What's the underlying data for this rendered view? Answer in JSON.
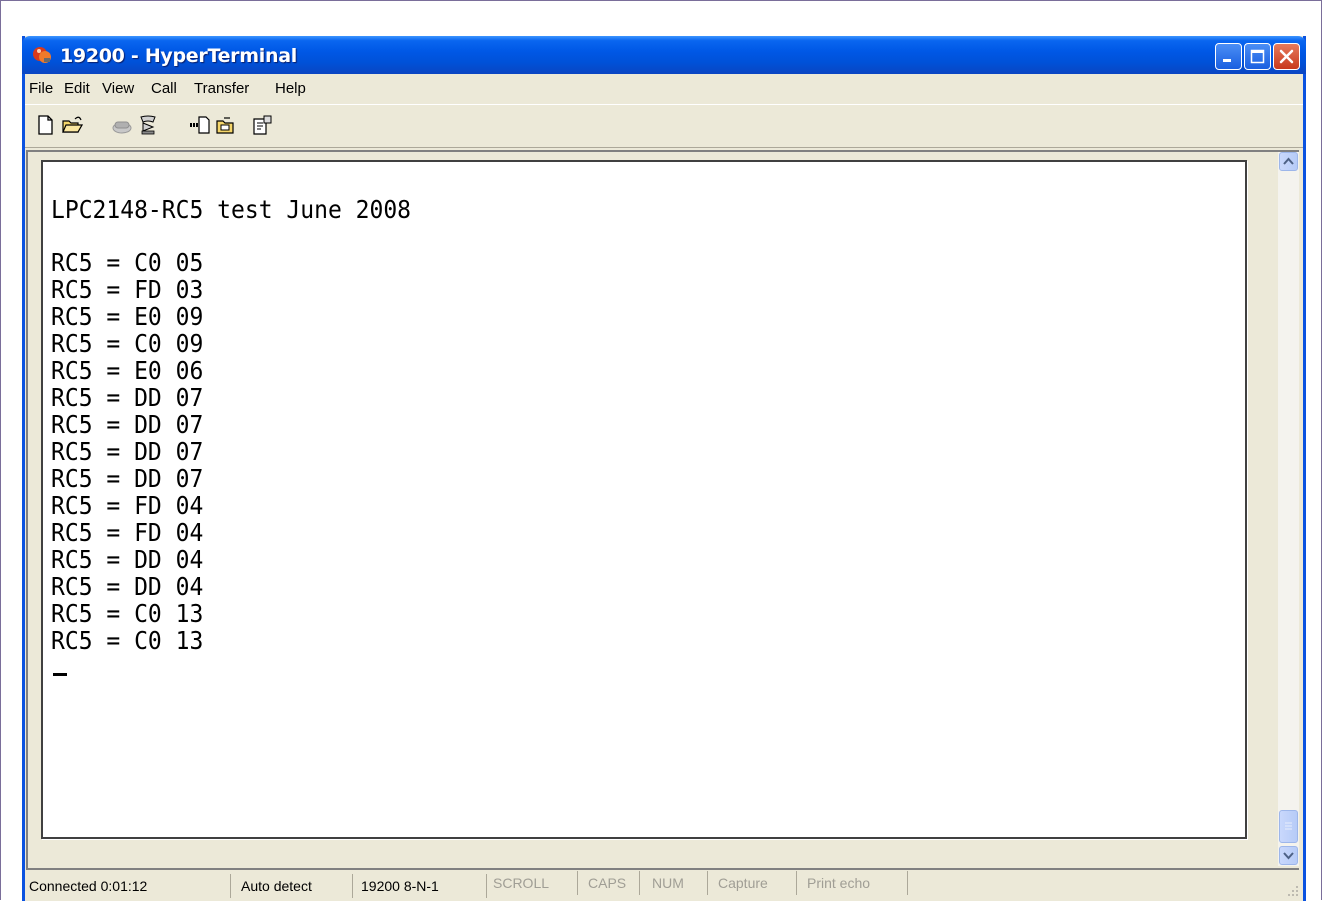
{
  "window": {
    "title": "19200 - HyperTerminal"
  },
  "menu": [
    "File",
    "Edit",
    "View",
    "Call",
    "Transfer",
    "Help"
  ],
  "toolbar": {
    "icons": [
      "new-icon",
      "open-icon",
      "call-icon",
      "disconnect-icon",
      "send-icon",
      "receive-icon",
      "properties-icon"
    ]
  },
  "terminal": {
    "header": "LPC2148-RC5 test June 2008",
    "lines": [
      "RC5 = C0 05",
      "RC5 = FD 03",
      "RC5 = E0 09",
      "RC5 = C0 09",
      "RC5 = E0 06",
      "RC5 = DD 07",
      "RC5 = DD 07",
      "RC5 = DD 07",
      "RC5 = DD 07",
      "RC5 = FD 04",
      "RC5 = FD 04",
      "RC5 = DD 04",
      "RC5 = DD 04",
      "RC5 = C0 13",
      "RC5 = C0 13"
    ]
  },
  "status": {
    "connection": "Connected 0:01:12",
    "emulation": "Auto detect",
    "settings": "19200 8-N-1",
    "scroll": "SCROLL",
    "caps": "CAPS",
    "num": "NUM",
    "capture": "Capture",
    "print_echo": "Print echo"
  },
  "colors": {
    "titlebar": "#0058e6",
    "window_face": "#ece9d8",
    "close_button": "#c8391d"
  }
}
